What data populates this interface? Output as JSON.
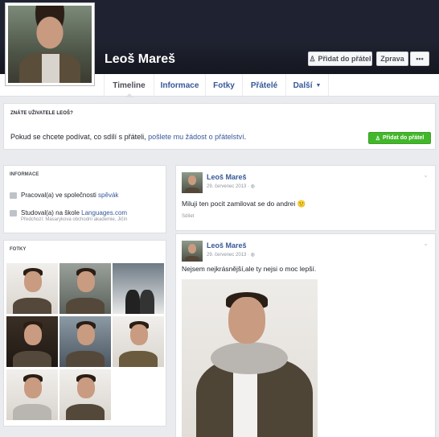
{
  "profile": {
    "name": "Leoš Mareš",
    "add_friend_label": "Přidat do přátel",
    "message_label": "Zprava",
    "more_label": "•••"
  },
  "nav": {
    "tabs": [
      {
        "label": "Timeline"
      },
      {
        "label": "Informace"
      },
      {
        "label": "Fotky"
      },
      {
        "label": "Přátelé"
      },
      {
        "label": "Další"
      }
    ]
  },
  "know": {
    "heading": "ZNÁTE UŽIVATELE LEOŠ?",
    "text_before": "Pokud se chcete podívat, co sdílí s přáteli, ",
    "link_text": "pošlete mu žádost o přátelství",
    "text_after": ".",
    "button_label": "Přidat do přátel"
  },
  "info": {
    "heading": "INFORMACE",
    "work_prefix": "Pracoval(a) ve společnosti ",
    "work_link": "spěvák",
    "study_prefix": "Studoval(a) na škole ",
    "study_link": "Languages.com",
    "study_sub": "Předchozí: Masarykova obchodní akademie, Jičín"
  },
  "photos": {
    "heading": "FOTKY"
  },
  "posts": [
    {
      "name": "Leoš Mareš",
      "date": "29. červenec 2013 · ",
      "text": "Miluji ten pocit zamilovat se do andrei 🙂",
      "action": "Sdílet"
    },
    {
      "name": "Leoš Mareš",
      "date": "29. červenec 2013 · ",
      "text": "Nejsem nejkrásnější,ale ty nejsi o moc lepší."
    }
  ]
}
